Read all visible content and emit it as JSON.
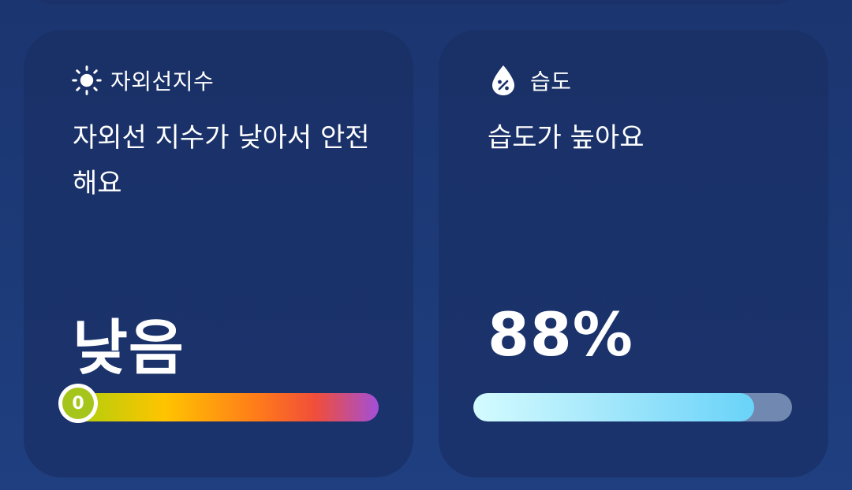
{
  "uv_card": {
    "title": "자외선지수",
    "icon": "sun-icon",
    "message": "자외선 지수가 낮아서 안전해요",
    "value": "낮음",
    "index_marker": "0",
    "index_level": 0,
    "bar_colors": [
      "#a3d10e",
      "#ffc400",
      "#ff7a1a",
      "#f04e3a",
      "#a24fd8"
    ]
  },
  "humidity_card": {
    "title": "습도",
    "icon": "humidity-drop-icon",
    "message": "습도가 높아요",
    "value": "88%",
    "level_percent": 88,
    "fill_color": "#69d3f9",
    "track_color": "#7188b0"
  },
  "colors": {
    "background": "#1d3a78",
    "card": "#1a3168"
  }
}
